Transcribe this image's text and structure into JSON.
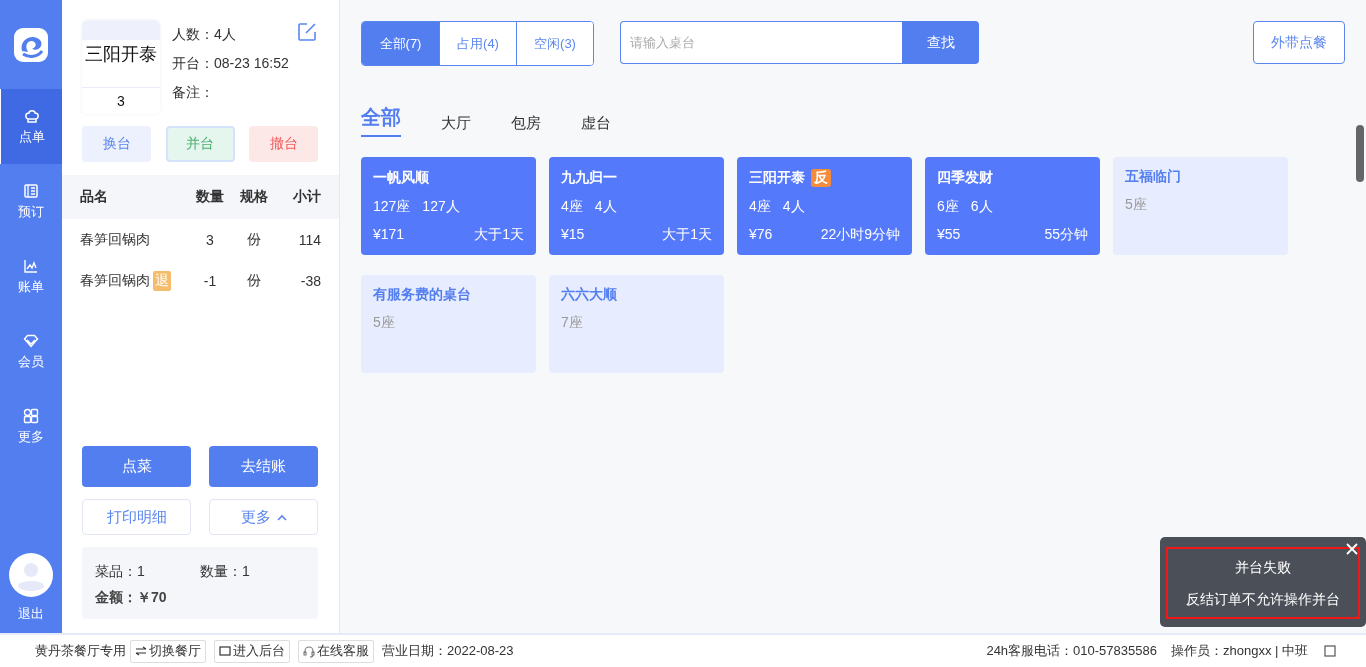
{
  "sidebar": {
    "items": [
      {
        "label": "点单",
        "selected": true
      },
      {
        "label": "预订",
        "selected": false
      },
      {
        "label": "账单",
        "selected": false
      },
      {
        "label": "会员",
        "selected": false
      },
      {
        "label": "更多",
        "selected": false
      }
    ],
    "logout": "退出"
  },
  "order": {
    "table_name": "三阳开泰",
    "table_number": "3",
    "info": [
      "人数：4人",
      "开台：08-23 16:52",
      "备注："
    ],
    "actions": [
      {
        "label": "换台",
        "kind": "blue",
        "selected": false
      },
      {
        "label": "并台",
        "kind": "green",
        "selected": true
      },
      {
        "label": "撤台",
        "kind": "red",
        "selected": false
      }
    ],
    "columns": [
      "品名",
      "数量",
      "规格",
      "小计"
    ],
    "rows": [
      {
        "name": "春笋回锅肉",
        "qty": "3",
        "unit": "份",
        "subtotal": "114"
      },
      {
        "name": "春笋回锅肉",
        "tag": "退",
        "qty": "-1",
        "unit": "份",
        "subtotal": "-38"
      }
    ],
    "primary_buttons": [
      "点菜",
      "去结账"
    ],
    "secondary_buttons": [
      "打印明细",
      "更多"
    ],
    "summary": {
      "dishes": "菜品：1",
      "quantity": "数量：1",
      "amount_label": "金额：",
      "amount": "￥70"
    }
  },
  "filters": [
    {
      "label": "全部(7)",
      "selected": true
    },
    {
      "label": "占用(4)",
      "selected": false
    },
    {
      "label": "空闲(3)",
      "selected": false
    }
  ],
  "search": {
    "placeholder": "请输入桌台",
    "button": "查找"
  },
  "takeout_button": "外带点餐",
  "areas": [
    {
      "label": "全部",
      "selected": true
    },
    {
      "label": "大厅",
      "selected": false
    },
    {
      "label": "包房",
      "selected": false
    },
    {
      "label": "虚台",
      "selected": false
    }
  ],
  "tables": [
    {
      "kind": "occupied",
      "name": "一帆风顺",
      "seats": "127座",
      "people": "127人",
      "amount": "¥171",
      "duration": "大于1天"
    },
    {
      "kind": "occupied",
      "name": "九九归一",
      "seats": "4座",
      "people": "4人",
      "amount": "¥15",
      "duration": "大于1天"
    },
    {
      "kind": "occupied",
      "name": "三阳开泰",
      "badge": "反",
      "seats": "4座",
      "people": "4人",
      "amount": "¥76",
      "duration": "22小时9分钟"
    },
    {
      "kind": "occupied",
      "name": "四季发财",
      "seats": "6座",
      "people": "6人",
      "amount": "¥55",
      "duration": "55分钟"
    },
    {
      "kind": "free",
      "name": "五福临门",
      "seats": "5座"
    },
    {
      "kind": "free",
      "name": "有服务费的桌台",
      "seats": "5座"
    },
    {
      "kind": "free",
      "name": "六六大顺",
      "seats": "7座"
    }
  ],
  "status_bar": {
    "restaurant": "黄丹茶餐厅专用",
    "buttons": [
      "切换餐厅",
      "进入后台",
      "在线客服"
    ],
    "business_date": "营业日期：2022-08-23",
    "hotline": "24h客服电话：010-57835586",
    "operator": "操作员：zhongxx | 中班"
  },
  "toast": {
    "title": "并台失败",
    "message": "反结订单不允许操作并台"
  }
}
